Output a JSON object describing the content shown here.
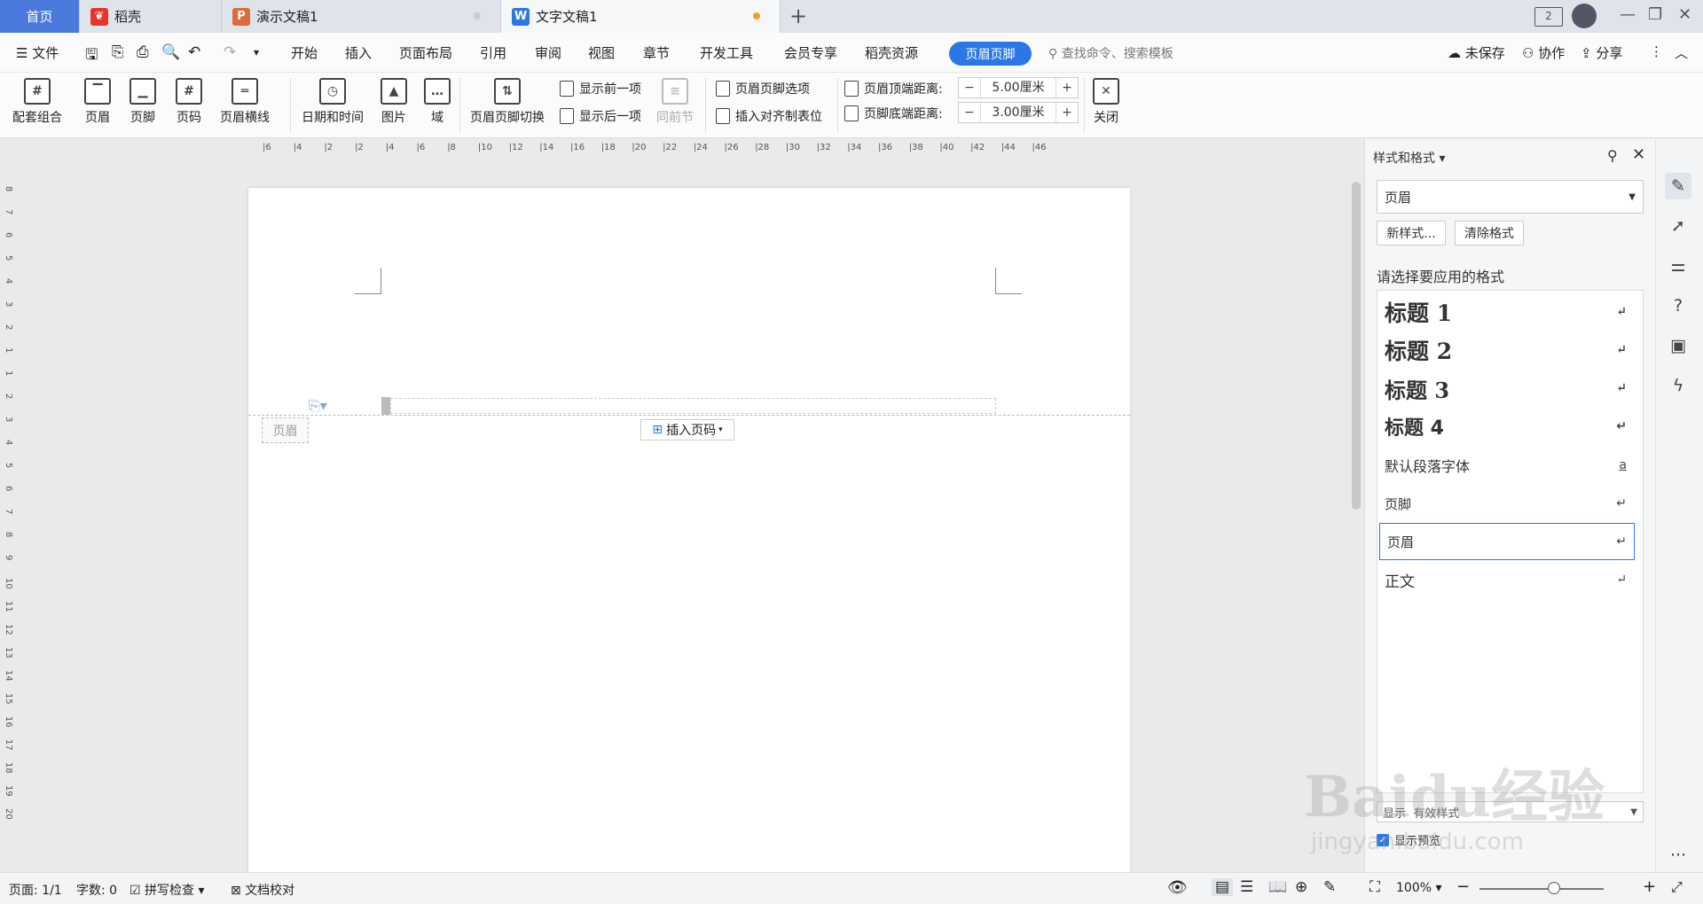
{
  "titlebar": {
    "tabs": [
      {
        "label": "首页"
      },
      {
        "label": "稻壳"
      },
      {
        "label": "演示文稿1"
      },
      {
        "label": "文字文稿1"
      }
    ],
    "new_tab": "+"
  },
  "menubar": {
    "file": "文件",
    "items": [
      "开始",
      "插入",
      "页面布局",
      "引用",
      "审阅",
      "视图",
      "章节",
      "开发工具",
      "会员专享",
      "稻壳资源"
    ],
    "active": "页眉页脚",
    "search_placeholder": "查找命令、搜索模板",
    "unsaved": "未保存",
    "collab": "协作",
    "share": "分享"
  },
  "ribbon": {
    "buttons": [
      "配套组合",
      "页眉",
      "页脚",
      "页码",
      "页眉横线",
      "日期和时间",
      "图片",
      "域",
      "页眉页脚切换",
      "关闭"
    ],
    "show_prev": "显示前一项",
    "show_next": "显示后一项",
    "same_section": "同前节",
    "hf_options": "页眉页脚选项",
    "insert_align": "插入对齐制表位",
    "header_top_label": "页眉顶端距离:",
    "header_top_value": "5.00厘米",
    "footer_bottom_label": "页脚底端距离:",
    "footer_bottom_value": "3.00厘米",
    "minus": "−",
    "plus": "+"
  },
  "ruler": {
    "h_ticks": [
      "6",
      "4",
      "2",
      "2",
      "4",
      "6",
      "8",
      "10",
      "12",
      "14",
      "16",
      "18",
      "20",
      "22",
      "24",
      "26",
      "28",
      "30",
      "32",
      "34",
      "36",
      "38",
      "40",
      "42",
      "44",
      "46"
    ],
    "v_ticks": [
      "8",
      "7",
      "6",
      "5",
      "4",
      "3",
      "2",
      "1",
      "1",
      "2",
      "3",
      "4",
      "5",
      "6",
      "7",
      "8",
      "9",
      "10",
      "11",
      "12",
      "13",
      "14",
      "15",
      "16",
      "17",
      "18",
      "19",
      "20"
    ]
  },
  "document": {
    "header_label": "页眉",
    "insert_page_number": "插入页码"
  },
  "style_panel": {
    "title": "样式和格式",
    "current_style": "页眉",
    "new_style": "新样式...",
    "clear_format": "清除格式",
    "choose_label": "请选择要应用的格式",
    "styles": [
      {
        "label": "标题  1",
        "mark": "↵"
      },
      {
        "label": "标题  2",
        "mark": "↵"
      },
      {
        "label": "标题  3",
        "mark": "↵"
      },
      {
        "label": "标题  4",
        "mark": "↵"
      },
      {
        "label": "默认段落字体",
        "mark": "a"
      },
      {
        "label": "页脚",
        "mark": "↵"
      },
      {
        "label": "页眉",
        "mark": "↵"
      },
      {
        "label": "正文",
        "mark": "↵"
      }
    ],
    "show_label": "显示",
    "show_value": "有效样式",
    "preview": "显示预览"
  },
  "statusbar": {
    "page": "页面: 1/1",
    "words": "字数: 0",
    "spell": "拼写检查",
    "proof": "文档校对",
    "zoom": "100%"
  },
  "colors": {
    "accent": "#2b78e4",
    "tab_home": "#4a7bdc",
    "wps_red": "#e8352b",
    "ppt_orange": "#e06a3b",
    "doc_blue": "#2b78e4"
  }
}
